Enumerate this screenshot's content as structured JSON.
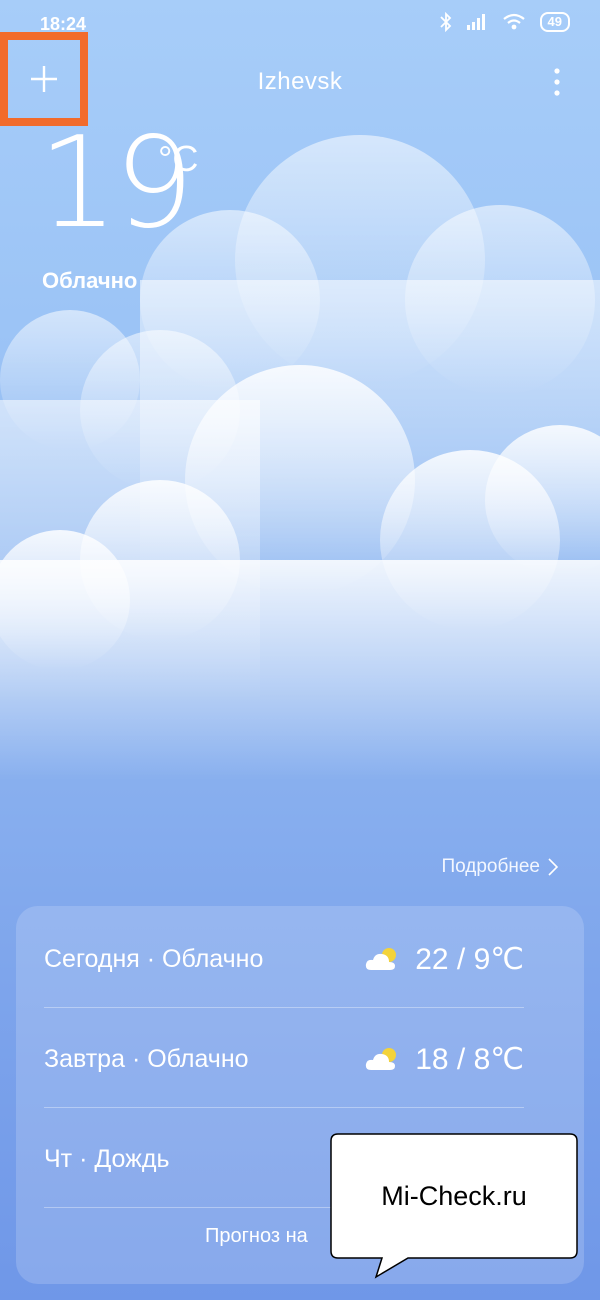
{
  "status": {
    "time": "18:24",
    "battery": "49"
  },
  "header": {
    "city": "Izhevsk"
  },
  "current": {
    "temperature": "19",
    "unit": "°C",
    "condition": "Облачно"
  },
  "details_link": "Подробнее",
  "forecast": [
    {
      "day": "Сегодня",
      "condition": "Облачно",
      "high": "22",
      "low": "9",
      "unit": "℃",
      "icon": "partly-cloudy-icon"
    },
    {
      "day": "Завтра",
      "condition": "Облачно",
      "high": "18",
      "low": "8",
      "unit": "℃",
      "icon": "partly-cloudy-icon"
    },
    {
      "day": "Чт",
      "condition": "Дождь"
    }
  ],
  "footer_link": "Прогноз на",
  "watermark": "Mi-Check.ru",
  "colors": {
    "highlight": "#f26b2b",
    "sky_top": "#a7cdf9",
    "sky_bottom": "#6f97e8",
    "sun": "#f3d33b"
  }
}
